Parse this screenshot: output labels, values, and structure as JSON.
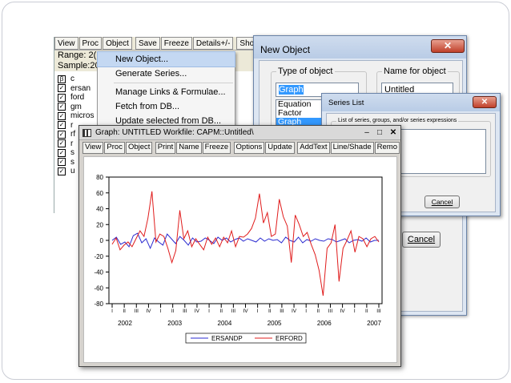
{
  "workfile": {
    "toolbar": [
      "View",
      "Proc",
      "Object",
      "Save",
      "Freeze",
      "Details+/-",
      "Show"
    ],
    "range_label": "Range:",
    "range_val": "2(",
    "sample_label": "Sample:",
    "sample_val": "20",
    "objects": [
      {
        "name": "c",
        "icon": "beta-icon"
      },
      {
        "name": "ersan",
        "icon": "series-icon"
      },
      {
        "name": "ford",
        "icon": "series-icon"
      },
      {
        "name": "gm",
        "icon": "series-icon"
      },
      {
        "name": "micros",
        "icon": "series-icon"
      },
      {
        "name": "r",
        "icon": "series-icon"
      },
      {
        "name": "rf",
        "icon": "series-icon"
      },
      {
        "name": "r",
        "icon": "series-icon"
      },
      {
        "name": "s",
        "icon": "series-icon"
      },
      {
        "name": "s",
        "icon": "series-icon"
      },
      {
        "name": "u",
        "icon": "series-icon"
      }
    ]
  },
  "menu": {
    "items": [
      "New Object...",
      "Generate Series...",
      "Manage Links & Formulae...",
      "Fetch from DB...",
      "Update selected from DB..."
    ]
  },
  "new_object": {
    "title": "New Object",
    "type_label": "Type of object",
    "type_value": "Graph",
    "type_options": [
      "Equation",
      "Factor",
      "Graph"
    ],
    "name_label": "Name for object",
    "name_value": "Untitled",
    "cancel": "Cancel"
  },
  "series_list": {
    "title": "Series List",
    "group_label": "List of series, groups, and/or series expressions",
    "cancel": "Cancel"
  },
  "graph": {
    "title": "Graph: UNTITLED   Workfile: CAPM::Untitled\\",
    "toolbar": [
      "View",
      "Proc",
      "Object",
      "|",
      "Print",
      "Name",
      "Freeze",
      "|",
      "Options",
      "Update",
      "|",
      "AddText",
      "Line/Shade",
      "Remo"
    ]
  },
  "chart_data": {
    "type": "line",
    "ylim": [
      -80,
      80
    ],
    "yticks": [
      80,
      60,
      40,
      20,
      0,
      -20,
      -40,
      -60,
      -80
    ],
    "year_labels": [
      "2002",
      "2003",
      "2004",
      "2005",
      "2006",
      "2007"
    ],
    "series": [
      {
        "name": "ERSANDP",
        "color": "#2b2bd0",
        "values": [
          0,
          4,
          -5,
          -2,
          -8,
          6,
          9,
          -3,
          2,
          -10,
          3,
          -2,
          -6,
          8,
          2,
          -4,
          5,
          0,
          -6,
          3,
          -2,
          -1,
          3,
          0,
          -4,
          4,
          0,
          3,
          -2,
          1,
          3,
          -1,
          2,
          0,
          -2,
          3,
          -1,
          2,
          0,
          1,
          -3,
          4,
          0,
          -2,
          4,
          -3,
          1,
          -1,
          2,
          0,
          -1,
          2,
          1,
          -2,
          0,
          2,
          -3,
          0,
          1,
          -1,
          3,
          -2,
          0,
          0
        ]
      },
      {
        "name": "ERFORD",
        "color": "#e01c1c",
        "values": [
          -5,
          3,
          -12,
          -6,
          -2,
          -8,
          2,
          12,
          5,
          28,
          62,
          -2,
          8,
          5,
          -10,
          -28,
          -13,
          38,
          2,
          12,
          -8,
          2,
          -5,
          -12,
          4,
          -5,
          3,
          -8,
          4,
          -3,
          12,
          -8,
          5,
          4,
          8,
          15,
          28,
          59,
          22,
          35,
          5,
          8,
          52,
          30,
          18,
          -28,
          32,
          20,
          5,
          10,
          -5,
          -18,
          -38,
          -70,
          -10,
          -3,
          20,
          -52,
          -10,
          0,
          12,
          -15,
          5,
          2,
          -8,
          2,
          5,
          -2
        ]
      }
    ]
  }
}
